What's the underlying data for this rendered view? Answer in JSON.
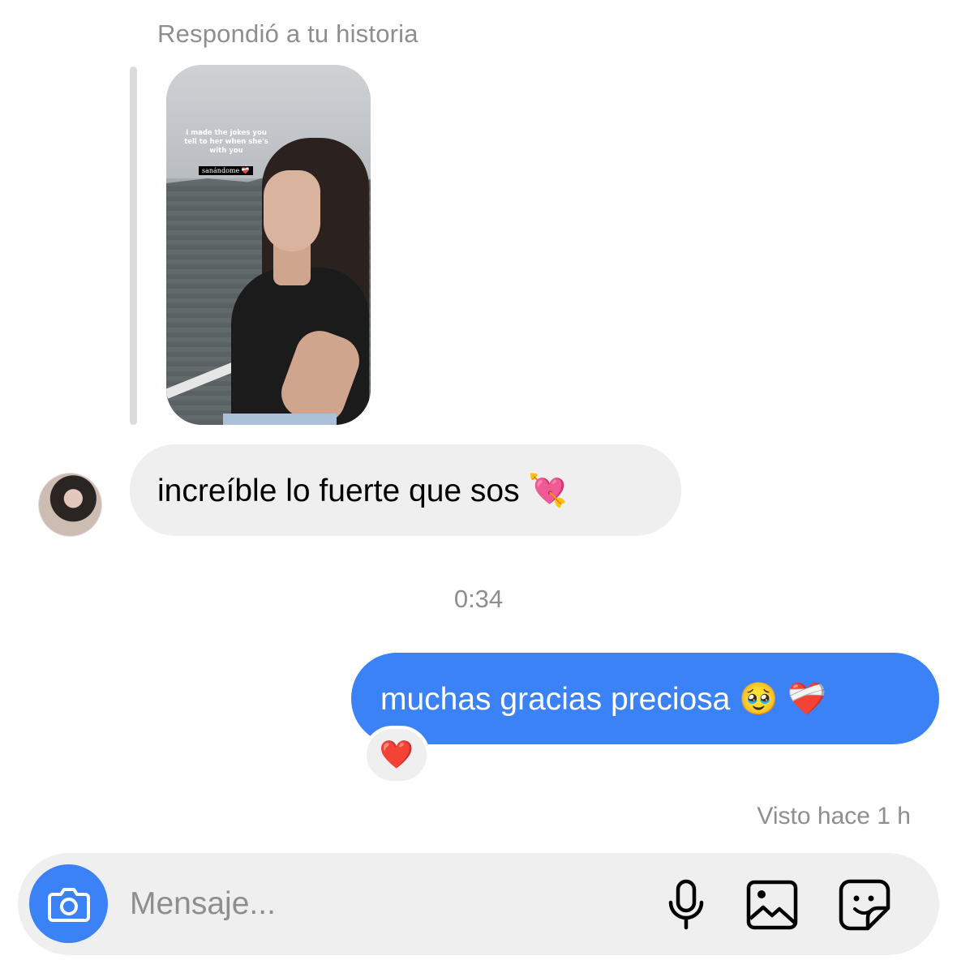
{
  "reply_header": "Respondió a tu historia",
  "story": {
    "caption": "I made the jokes you tell to her when she's with you",
    "tag": "sanándome ❤️‍🩹"
  },
  "messages": {
    "incoming": {
      "text": "increíble lo fuerte que sos 💘"
    },
    "timestamp": "0:34",
    "outgoing": {
      "text": "muchas gracias preciosa 🥹 ❤️‍🩹",
      "reaction": "❤️"
    },
    "seen": "Visto hace 1 h"
  },
  "composer": {
    "placeholder": "Mensaje...",
    "icons": [
      "camera-icon",
      "microphone-icon",
      "gallery-icon",
      "sticker-icon"
    ]
  },
  "colors": {
    "accent": "#3b82f6",
    "bubble_gray": "#efefef",
    "meta_gray": "#8e8e8e"
  }
}
